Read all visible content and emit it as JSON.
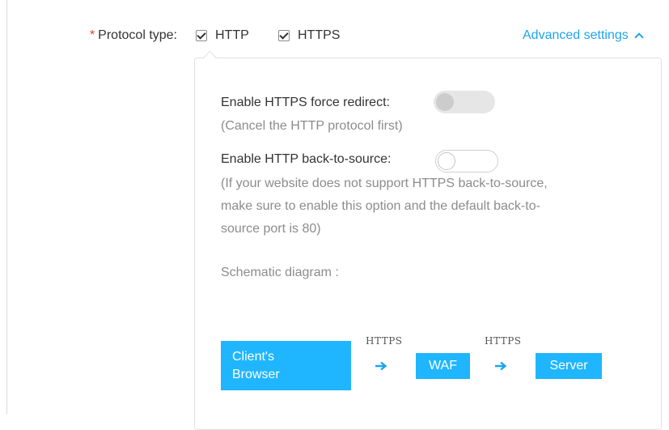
{
  "protocol": {
    "required_mark": "*",
    "label": "Protocol type:",
    "options": [
      {
        "label": "HTTP",
        "checked": true
      },
      {
        "label": "HTTPS",
        "checked": true
      }
    ],
    "advanced_link": "Advanced settings",
    "advanced_icon": "chevron-up-icon"
  },
  "advanced": {
    "force_redirect": {
      "label": "Enable HTTPS force redirect:",
      "hint": "(Cancel the HTTP protocol first)",
      "enabled": false,
      "disabled": true
    },
    "back_to_source": {
      "label": "Enable HTTP back-to-source:",
      "hint_lines": [
        "(If your website does not support HTTPS back-to-source,",
        "make sure to enable this option and the default back-to-",
        "source port is 80)"
      ],
      "enabled": false
    },
    "diagram": {
      "title": "Schematic diagram :",
      "client_lines": [
        "Client's",
        "Browser"
      ],
      "waf": "WAF",
      "server": "Server",
      "link_labels": [
        "HTTPS",
        "HTTPS"
      ],
      "arrow_icon": "arrow-right-icon"
    }
  },
  "colors": {
    "accent": "#1fa4ee",
    "diagram_box": "#1fb6ff",
    "required": "#e03c31",
    "text": "#333333",
    "muted": "#8c8c8c"
  }
}
